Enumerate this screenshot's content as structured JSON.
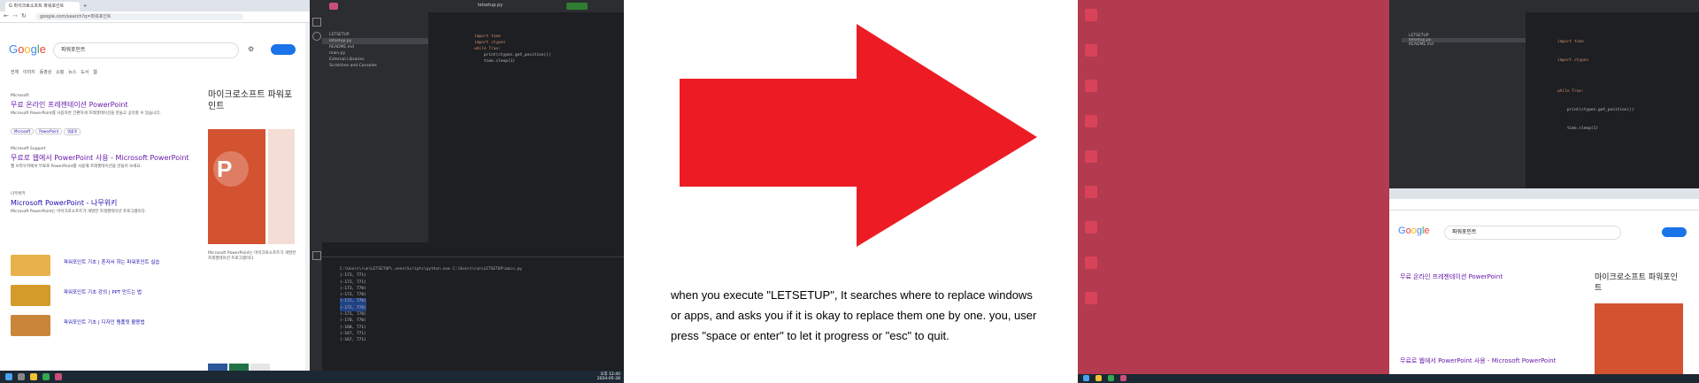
{
  "caption": "when you execute \"LETSETUP\", It searches where to replace windows or apps, and asks you if it is okay to replace them one by one. you, user press \"space or enter\" to let it progress or \"esc\" to quit.",
  "colors": {
    "arrow": "#ed1c24",
    "desktop": "#b33a4f",
    "ide_bg": "#1e1f22",
    "google_blue": "#1a73e8"
  },
  "left": {
    "browser": {
      "tab1": "G 마이크로소프트 파워포인트",
      "search_query": "파워포인트",
      "search_tabs": [
        "전체",
        "이미지",
        "동영상",
        "쇼핑",
        "뉴스",
        "도서",
        "웹"
      ],
      "results": [
        {
          "source": "Microsoft",
          "title": "무료 온라인 프레젠테이션 PowerPoint"
        },
        {
          "source": "Microsoft Support",
          "title": "무료로 웹에서 PowerPoint 사용 - Microsoft PowerPoint"
        },
        {
          "source": "나무위키",
          "title": "Microsoft PowerPoint - 나무위키"
        }
      ],
      "kp_title": "마이크로소프트 파워포인트",
      "kp_snippet": "Microsoft PowerPoint는 마이크로소프트가 개발한 프레젠테이션 프로그램이다.",
      "videos": [
        "파워포인트 기초 | 혼자서 하는 파워포인트 실습",
        "파워포인트 기초 강의 | PPT 만드는 법",
        "파워포인트 기초 | 디자인 템플릿 활용법"
      ]
    },
    "ide": {
      "tree": [
        "LETSETUP",
        "letsetup.py",
        "README.md",
        "main.py",
        "External Libraries",
        "Scratches and Consoles"
      ],
      "code": [
        "import time",
        "import ctypes",
        "",
        "while True:",
        "    print(ctypes.get_position())",
        "    time.sleep(1)"
      ],
      "terminal": [
        "C:\\Users\\run\\LETSETUP\\.venv\\Scripts\\python.exe C:\\Users\\run\\LETSETUP\\main.py",
        "(-173, 771)",
        "(-173, 771)",
        "(-173, 770)",
        "(-173, 770)",
        "(-172, 770)",
        "(-172, 770)",
        "(-171, 770)",
        "(-170, 770)",
        "(-168, 771)",
        "(-167, 771)",
        "(-167, 771)"
      ]
    },
    "clock": [
      "오후 12:40",
      "2024-05-28"
    ]
  },
  "right": {
    "browser": {
      "search_query": "파워포인트",
      "kp_title": "마이크로소프트 파워포인트"
    }
  }
}
